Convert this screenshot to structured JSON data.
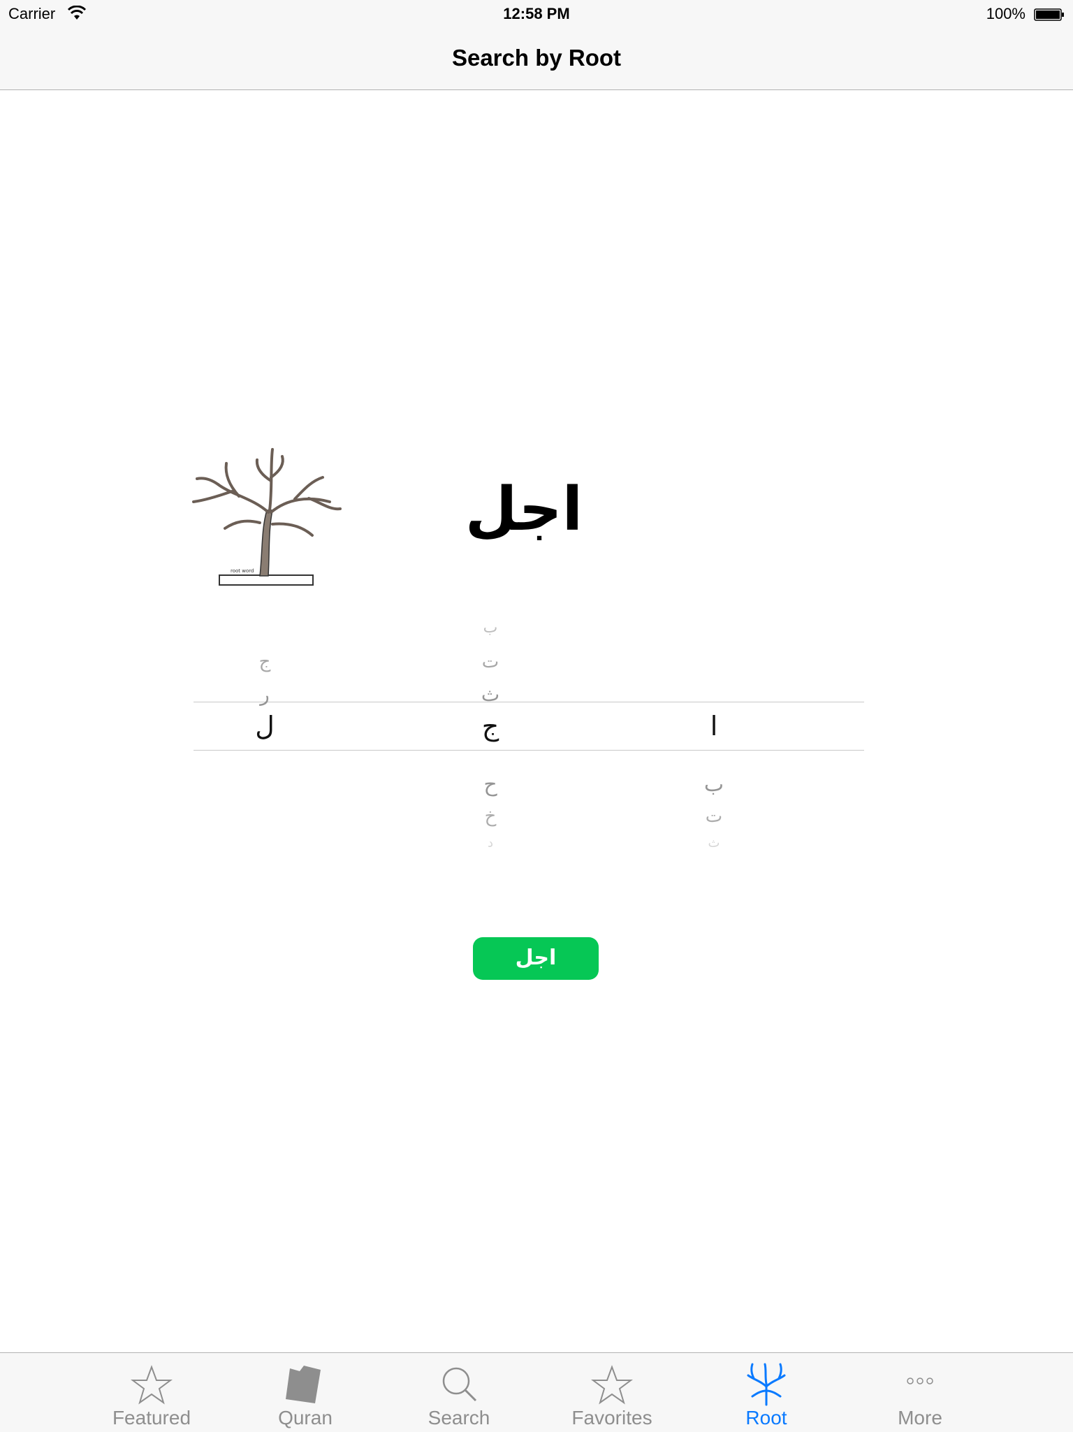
{
  "status_bar": {
    "carrier": "Carrier",
    "time": "12:58 PM",
    "battery": "100%"
  },
  "nav": {
    "title": "Search by Root"
  },
  "root_display": "اجل",
  "picker": {
    "columns": [
      {
        "above": [
          "ج",
          "ر"
        ],
        "selected": "ل",
        "below": []
      },
      {
        "above": [
          "ب",
          "ت",
          "ث"
        ],
        "selected": "ج",
        "below": [
          "ح",
          "خ",
          "د"
        ]
      },
      {
        "above": [],
        "selected": "ا",
        "below": [
          "ب",
          "ت",
          "ث"
        ]
      }
    ]
  },
  "search_button": {
    "label": "اجل",
    "color": "#06c755"
  },
  "tabs": [
    {
      "label": "Featured",
      "icon": "star-icon",
      "active": false
    },
    {
      "label": "Quran",
      "icon": "quran-book-icon",
      "active": false
    },
    {
      "label": "Search",
      "icon": "magnifier-icon",
      "active": false
    },
    {
      "label": "Favorites",
      "icon": "star-icon",
      "active": false
    },
    {
      "label": "Root",
      "icon": "tree-icon",
      "active": true
    },
    {
      "label": "More",
      "icon": "ellipsis-icon",
      "active": false
    }
  ],
  "colors": {
    "accent": "#0a7aff",
    "tab_inactive": "#8e8e8e",
    "bar_bg": "#f7f7f7"
  }
}
